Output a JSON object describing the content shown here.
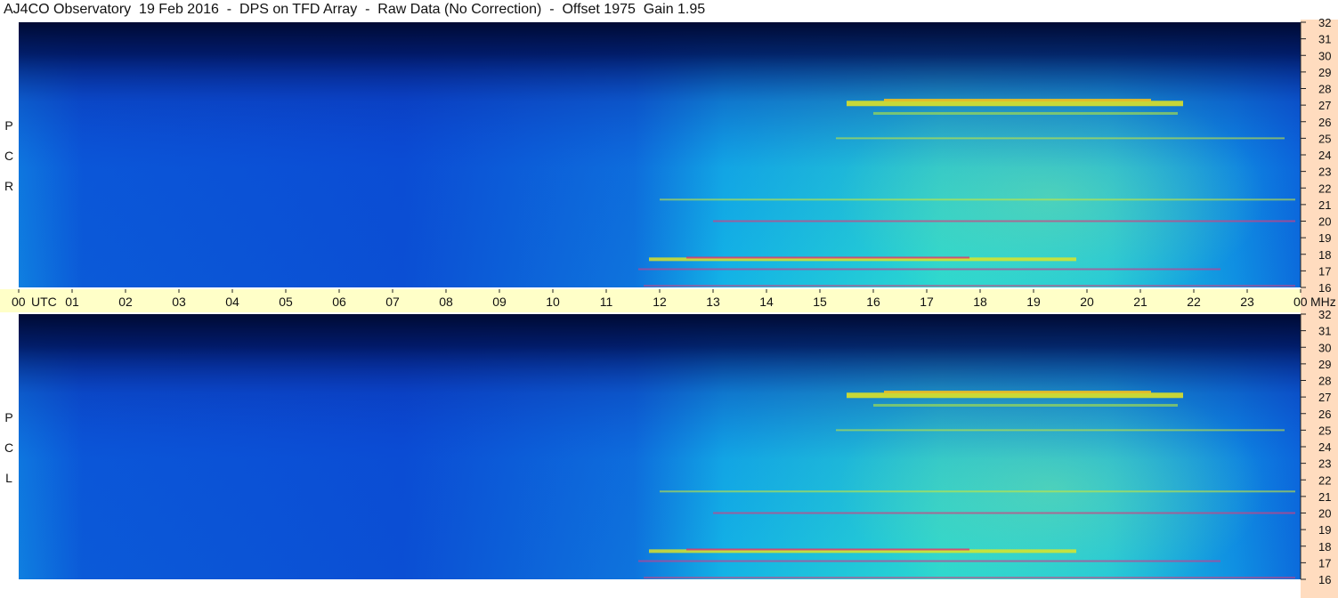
{
  "title": "AJ4CO Observatory  19 Feb 2016  -  DPS on TFD Array  -  Raw Data (No Correction)  -  Offset 1975  Gain 1.95",
  "panels": [
    {
      "label_letters": [
        "P",
        "C",
        "R"
      ]
    },
    {
      "label_letters": [
        "P",
        "C",
        "L"
      ]
    }
  ],
  "time_axis": {
    "labels": [
      "00",
      "01",
      "02",
      "03",
      "04",
      "05",
      "06",
      "07",
      "08",
      "09",
      "10",
      "11",
      "12",
      "13",
      "14",
      "15",
      "16",
      "17",
      "18",
      "19",
      "20",
      "21",
      "22",
      "23",
      "00"
    ],
    "unit_left": "UTC",
    "unit_right": "MHz"
  },
  "colors": {
    "axis_band": "#ffffc8",
    "right_strip": "#ffdcbf",
    "deep": "#000a33",
    "blue": "#0a3bd6",
    "cyan": "#14c8e6",
    "yellow": "#e6e61e"
  },
  "chart_data": {
    "type": "heatmap",
    "title": "AJ4CO Observatory  19 Feb 2016  -  DPS on TFD Array  -  Raw Data (No Correction)  -  Offset 1975  Gain 1.95",
    "x": {
      "label": "UTC",
      "range": [
        0,
        24
      ],
      "ticks": [
        "00",
        "01",
        "02",
        "03",
        "04",
        "05",
        "06",
        "07",
        "08",
        "09",
        "10",
        "11",
        "12",
        "13",
        "14",
        "15",
        "16",
        "17",
        "18",
        "19",
        "20",
        "21",
        "22",
        "23",
        "00"
      ]
    },
    "y": {
      "label": "MHz",
      "range": [
        16,
        32
      ],
      "ticks": [
        16,
        17,
        18,
        19,
        20,
        21,
        22,
        23,
        24,
        25,
        26,
        27,
        28,
        29,
        30,
        31,
        32
      ]
    },
    "panels": [
      "RCP",
      "LCP"
    ]
  }
}
